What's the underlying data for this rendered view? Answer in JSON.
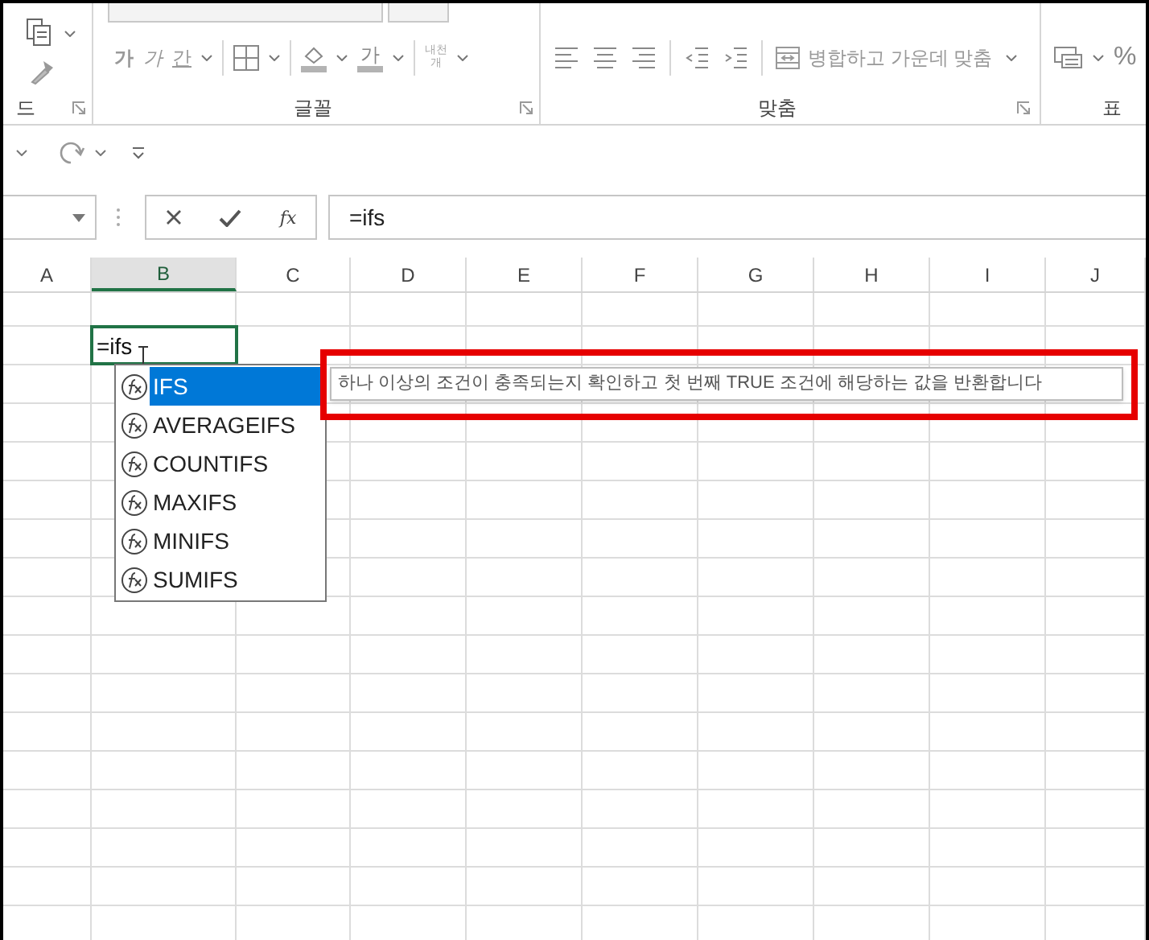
{
  "ribbon": {
    "groups": [
      {
        "kind": "clipboard",
        "label": "드"
      },
      {
        "kind": "font",
        "label": "글꼴",
        "styles": [
          "가",
          "가",
          "간"
        ],
        "font_color": "가",
        "phonetic": [
          "내천",
          "개"
        ]
      },
      {
        "kind": "alignment",
        "label": "맞춤",
        "merge_button": "병합하고 가운데 맞춤"
      },
      {
        "kind": "number",
        "label": "표",
        "percent": "%"
      }
    ]
  },
  "formula_bar": {
    "function_symbol": "fx",
    "formula": "=ifs"
  },
  "columns": [
    {
      "label": "A",
      "selected": false
    },
    {
      "label": "B",
      "selected": true
    },
    {
      "label": "C",
      "selected": false
    },
    {
      "label": "D",
      "selected": false
    },
    {
      "label": "E",
      "selected": false
    },
    {
      "label": "F",
      "selected": false
    },
    {
      "label": "G",
      "selected": false
    },
    {
      "label": "H",
      "selected": false
    },
    {
      "label": "I",
      "selected": false
    },
    {
      "label": "J",
      "selected": false
    }
  ],
  "active_cell": {
    "value": "=ifs"
  },
  "autocomplete": {
    "items": [
      {
        "label": "IFS",
        "selected": true
      },
      {
        "label": "AVERAGEIFS",
        "selected": false
      },
      {
        "label": "COUNTIFS",
        "selected": false
      },
      {
        "label": "MAXIFS",
        "selected": false
      },
      {
        "label": "MINIFS",
        "selected": false
      },
      {
        "label": "SUMIFS",
        "selected": false
      }
    ]
  },
  "tooltip": "하나 이상의 조건이 충족되는지 확인하고 첫 번째 TRUE 조건에 해당하는 값을 반환합니다"
}
